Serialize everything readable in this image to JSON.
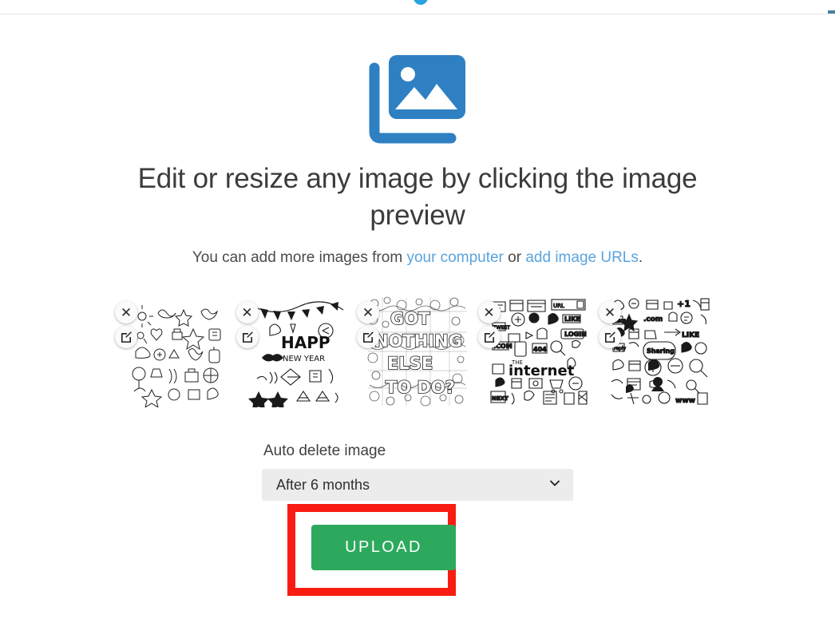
{
  "page": {
    "headline": "Edit or resize any image by clicking the image preview",
    "subtitle": {
      "prefix": "You can add more images from ",
      "link_computer": "your computer",
      "middle": " or ",
      "link_urls": "add image URLs",
      "suffix": "."
    },
    "logo_icon": "images-icon"
  },
  "thumbnails": {
    "remove_icon": "close-icon",
    "remove_label": "✕",
    "edit_icon": "edit-square-icon",
    "items": [
      {
        "alt": "doodle set with suns, hearts, stars and arrows",
        "caption": ""
      },
      {
        "alt": "happy new year doodles with bunting, moustache and stars",
        "caption": "HAPPY NEW YEAR"
      },
      {
        "alt": "dense doodle lettering poster",
        "caption": "GOT NOTHING ELSE TO DO?"
      },
      {
        "alt": "internet themed doodle icons",
        "caption": "THE internet"
      },
      {
        "alt": "social media doodle icons",
        "caption": ""
      }
    ]
  },
  "auto_delete": {
    "label": "Auto delete image",
    "selected": "After 6 months",
    "chevron_icon": "chevron-down-icon",
    "options": [
      "After 6 months"
    ]
  },
  "upload": {
    "button_label": "UPLOAD",
    "highlight": "red-annotation-box"
  },
  "colors": {
    "logo_blue": "#2f80c2",
    "link_blue": "#5ba4dd",
    "upload_green": "#2da95e",
    "annotation_red": "#f91c12",
    "select_gray": "#ececec",
    "text_dark": "#3c3c3c"
  }
}
